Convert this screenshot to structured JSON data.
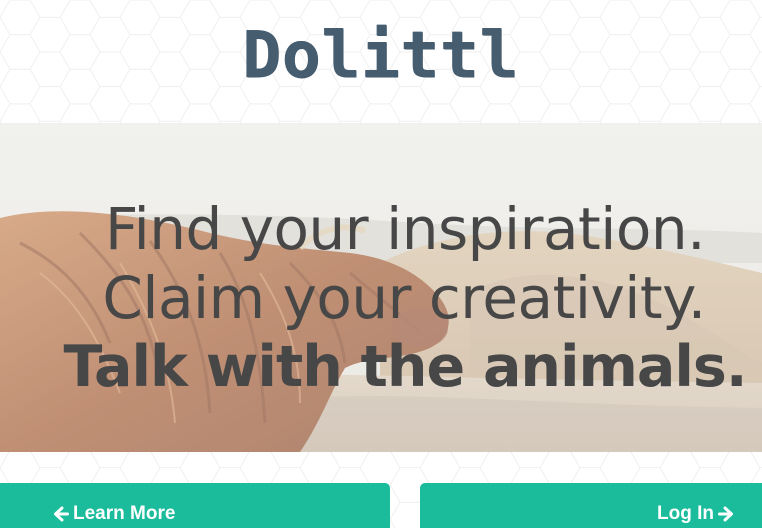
{
  "brand": {
    "logo_text": "Dolittl"
  },
  "hero": {
    "line1": "Find your inspiration.",
    "line2": "Claim your creativity.",
    "line3": "Talk with the animals.",
    "image_subject": "highland-cow-photo"
  },
  "actions": {
    "learn_more_label": "Learn More",
    "learn_more_icon": "arrow-left-icon",
    "login_label": "Log In",
    "login_icon": "arrow-right-icon"
  },
  "colors": {
    "accent": "#1abc9c",
    "logo": "#465d70",
    "hero_text": "#474747"
  }
}
